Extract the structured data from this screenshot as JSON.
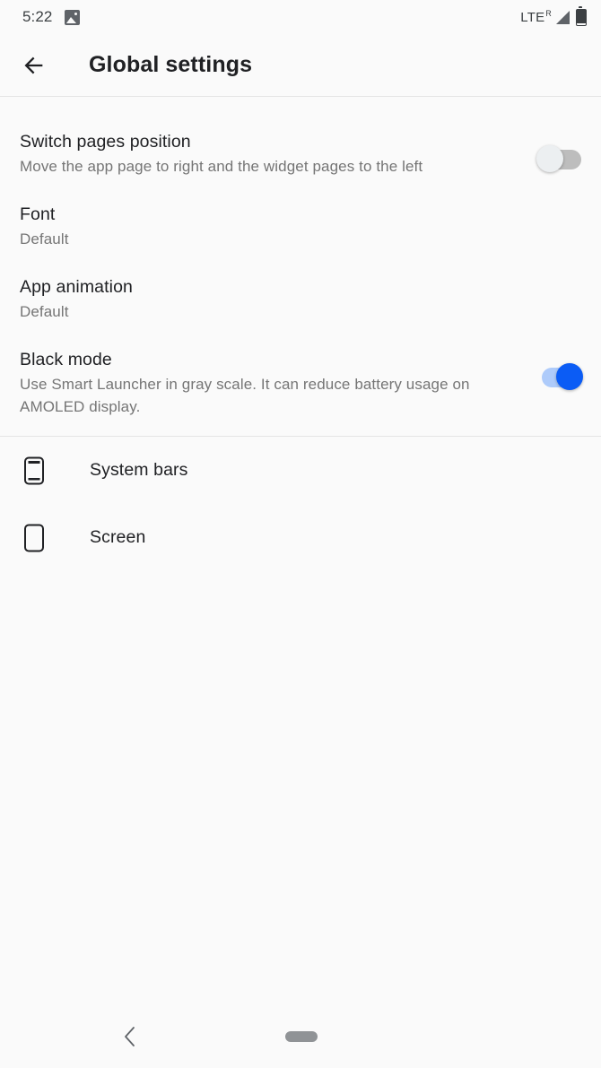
{
  "status_bar": {
    "clock": "5:22",
    "left_icons": [
      "photo-icon"
    ],
    "network_label": "LTE",
    "network_superscript": "R",
    "right_icons": [
      "signal-icon",
      "battery-icon"
    ]
  },
  "app_bar": {
    "back_icon": "back-arrow-icon",
    "title": "Global settings"
  },
  "settings": [
    {
      "key": "switch_pages_position",
      "title": "Switch pages position",
      "subtitle": "Move the app page to right and the widget pages to the left",
      "control": "switch",
      "value": "off"
    },
    {
      "key": "font",
      "title": "Font",
      "subtitle": "Default",
      "control": "none",
      "value": "Default"
    },
    {
      "key": "app_animation",
      "title": "App animation",
      "subtitle": "Default",
      "control": "none",
      "value": "Default"
    },
    {
      "key": "black_mode",
      "title": "Black mode",
      "subtitle": "Use Smart Launcher in gray scale. It can reduce battery usage on AMOLED display.",
      "control": "switch",
      "value": "on"
    }
  ],
  "nav_items": [
    {
      "key": "system_bars",
      "label": "System bars",
      "icon": "phone-system-bars-icon"
    },
    {
      "key": "screen",
      "label": "Screen",
      "icon": "phone-screen-icon"
    }
  ],
  "nav_bar": {
    "back_icon": "nav-back-chevron-icon",
    "home_icon": "home-pill-icon"
  },
  "colors": {
    "background": "#fafafa",
    "title_text": "#202124",
    "subtitle_text": "#757575",
    "divider": "#e4e4e4",
    "switch_on_knob": "#0b5cf5",
    "switch_on_track": "#aecbfa",
    "switch_off_knob": "#eceff1",
    "switch_off_track": "#bdbdbd",
    "nav_pill": "#909396"
  }
}
